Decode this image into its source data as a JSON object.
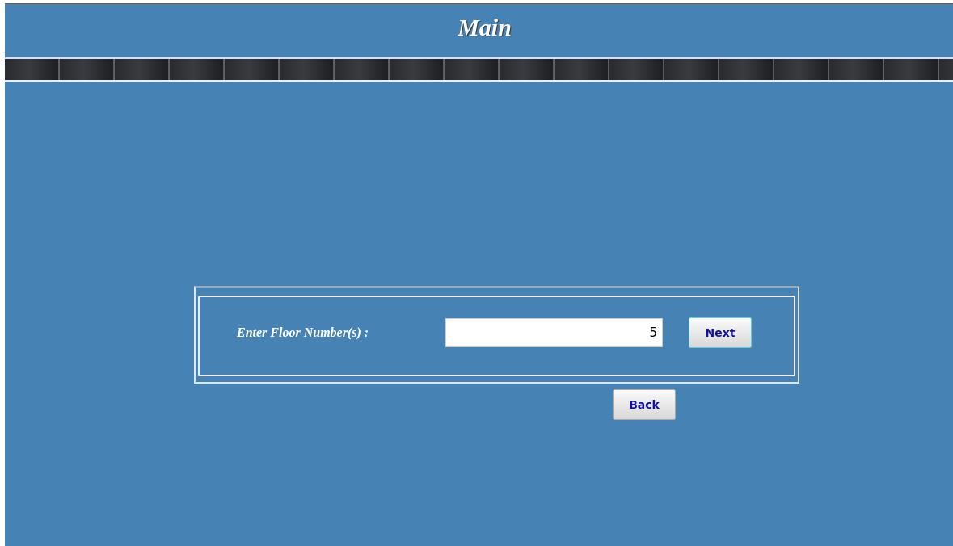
{
  "header": {
    "title": "Main"
  },
  "form": {
    "label": "Enter Floor Number(s) :",
    "value": "5",
    "next_button": "Next"
  },
  "back_button": "Back"
}
